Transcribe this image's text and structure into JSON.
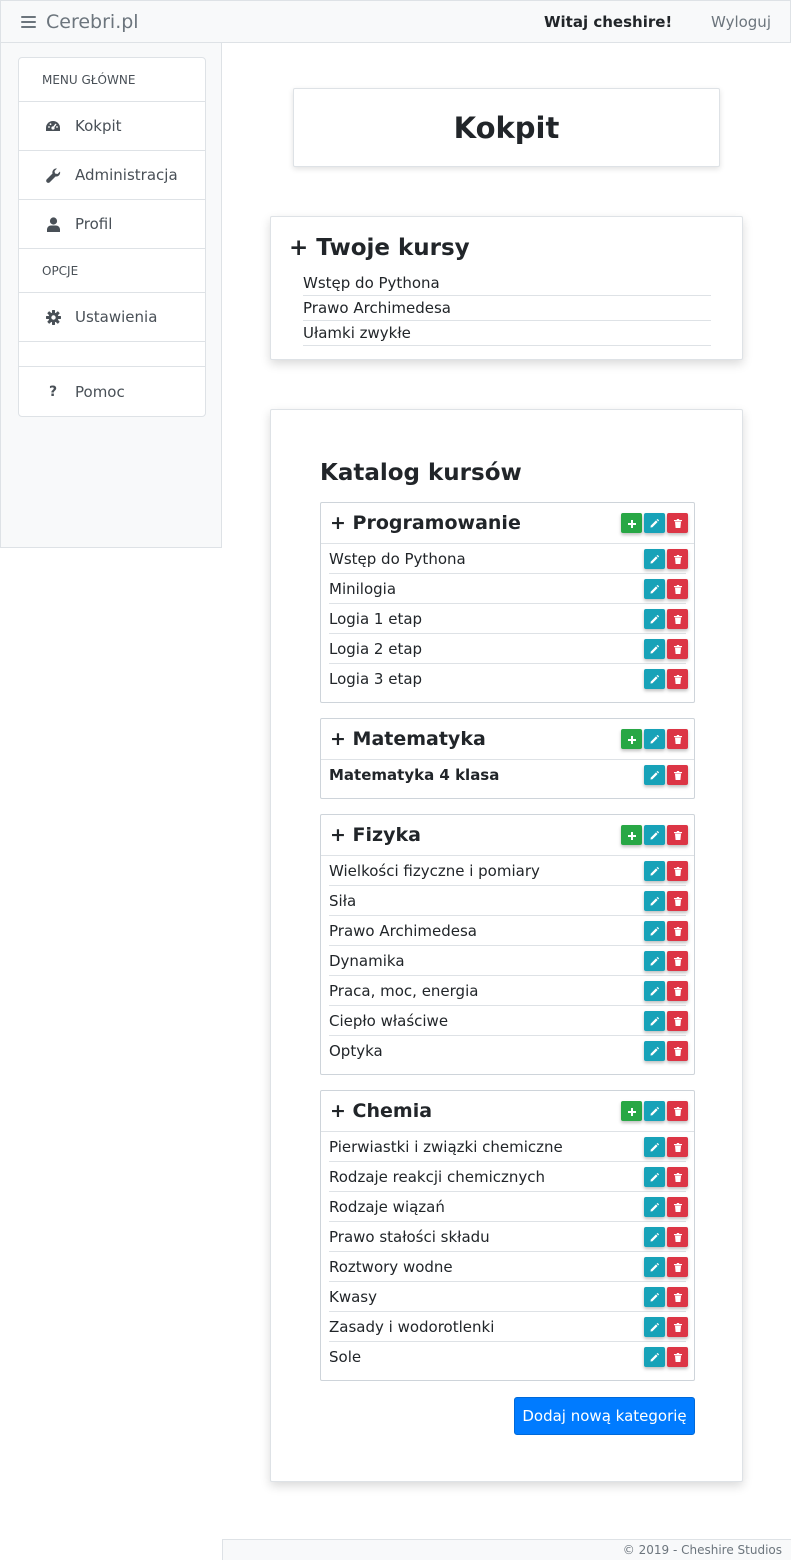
{
  "navbar": {
    "brand": "Cerebri.pl",
    "brand_icon": "hamburger-icon",
    "welcome": "Witaj cheshire!",
    "logout": "Wyloguj"
  },
  "sidebar": {
    "main_header": "MENU GŁÓWNE",
    "options_header": "OPCJE",
    "items": [
      {
        "label": "Kokpit",
        "icon": "dashboard-icon"
      },
      {
        "label": "Administracja",
        "icon": "wrench-icon"
      },
      {
        "label": "Profil",
        "icon": "user-icon"
      },
      {
        "label": "Ustawienia",
        "icon": "gear-icon"
      },
      {
        "label": "Pomoc",
        "icon": "question-icon"
      }
    ]
  },
  "page_title": "Kokpit",
  "my_courses": {
    "title": "+ Twoje kursy",
    "items": [
      "Wstęp do Pythona",
      "Prawo Archimedesa",
      "Ułamki zwykłe"
    ]
  },
  "catalog": {
    "title": "Katalog kursów",
    "add_category_button": "Dodaj nową kategorię",
    "categories": [
      {
        "name": "+ Programowanie",
        "courses": [
          "Wstęp do Pythona",
          "Minilogia",
          "Logia 1 etap",
          "Logia 2 etap",
          "Logia 3 etap"
        ]
      },
      {
        "name": "+ Matematyka",
        "courses": [
          "Matematyka 4 klasa"
        ]
      },
      {
        "name": "+ Fizyka",
        "courses": [
          "Wielkości fizyczne i pomiary",
          "Siła",
          "Prawo Archimedesa",
          "Dynamika",
          "Praca, moc, energia",
          "Ciepło właściwe",
          "Optyka"
        ]
      },
      {
        "name": "+ Chemia",
        "courses": [
          "Pierwiastki i związki chemiczne",
          "Rodzaje reakcji chemicznych",
          "Rodzaje wiązań",
          "Prawo stałości składu",
          "Roztwory wodne",
          "Kwasy",
          "Zasady i wodorotlenki",
          "Sole"
        ]
      }
    ]
  },
  "footer": "© 2019 - Cheshire Studios",
  "colors": {
    "add": "#28a745",
    "edit": "#17a2b8",
    "delete": "#dc3545",
    "primary": "#007bff"
  }
}
